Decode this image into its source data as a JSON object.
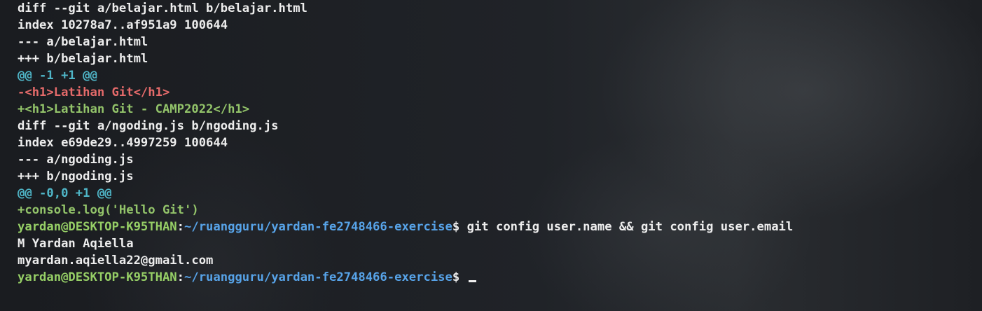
{
  "terminal": {
    "diff_lines": [
      {
        "text": "diff --git a/belajar.html b/belajar.html",
        "kind": "header"
      },
      {
        "text": "index 10278a7..af951a9 100644",
        "kind": "header"
      },
      {
        "text": "--- a/belajar.html",
        "kind": "header"
      },
      {
        "text": "+++ b/belajar.html",
        "kind": "header"
      },
      {
        "text": "@@ -1 +1 @@",
        "kind": "hunk"
      },
      {
        "text": "-<h1>Latihan Git</h1>",
        "kind": "deleted"
      },
      {
        "text": "+<h1>Latihan Git - CAMP2022</h1>",
        "kind": "added"
      },
      {
        "text": "diff --git a/ngoding.js b/ngoding.js",
        "kind": "header"
      },
      {
        "text": "index e69de29..4997259 100644",
        "kind": "header"
      },
      {
        "text": "--- a/ngoding.js",
        "kind": "header"
      },
      {
        "text": "+++ b/ngoding.js",
        "kind": "header"
      },
      {
        "text": "@@ -0,0 +1 @@",
        "kind": "hunk"
      },
      {
        "text": "+console.log('Hello Git')",
        "kind": "added"
      }
    ],
    "prompt1": {
      "user": "yardan@DESKTOP-K95THAN",
      "colon": ":",
      "path": "~/ruangguru/yardan-fe2748466-exercise",
      "dollar": "$",
      "command": " git config user.name && git config user.email"
    },
    "output": [
      "M Yardan Aqiella",
      "myardan.aqiella22@gmail.com"
    ],
    "prompt2": {
      "user": "yardan@DESKTOP-K95THAN",
      "colon": ":",
      "path": "~/ruangguru/yardan-fe2748466-exercise",
      "dollar": "$",
      "command": " "
    },
    "colors": {
      "header": "#ededed",
      "hunk": "#4fb6c8",
      "deleted": "#e46a6a",
      "added": "#93c46a",
      "user": "#96cf66",
      "path": "#57a3e8"
    }
  }
}
